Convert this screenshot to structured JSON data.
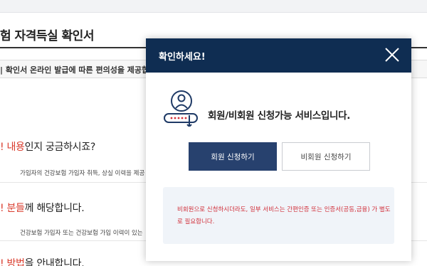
{
  "background": {
    "page_title": "험 자격득실 확인서",
    "notice": "| 확인서 온라인 발급에 따른 편의성을 제공합",
    "questions": [
      {
        "highlight": "! 내용",
        "rest": "인지 궁금하시죠?"
      },
      {
        "highlight": "! 분들",
        "rest": "께 해당합니다."
      },
      {
        "highlight": "! 방법",
        "rest": "을 안내합니다."
      }
    ],
    "descriptions": [
      "가입자의 건강보험 가입자 취득, 상실 이력을 제공",
      "건강보험 가입자 또는 건강보험 가입 이력이 있는"
    ]
  },
  "modal": {
    "title": "확인하세요!",
    "icon": "member-id-card-icon",
    "message": "회원/비회원 신청가능 서비스입니다.",
    "member_button": "회원 신청하기",
    "nonmember_button": "비회원 신청하기",
    "info": "비회원으로 신청하시더라도, 일부 서비스는 간편인증 또는 인증서(공동,금융) 가 별도로 필요합니다.",
    "colors": {
      "header": "#0f2d52",
      "primary_button": "#27416e",
      "info_text": "#d12f3a",
      "highlight": "#d93a2b"
    }
  }
}
